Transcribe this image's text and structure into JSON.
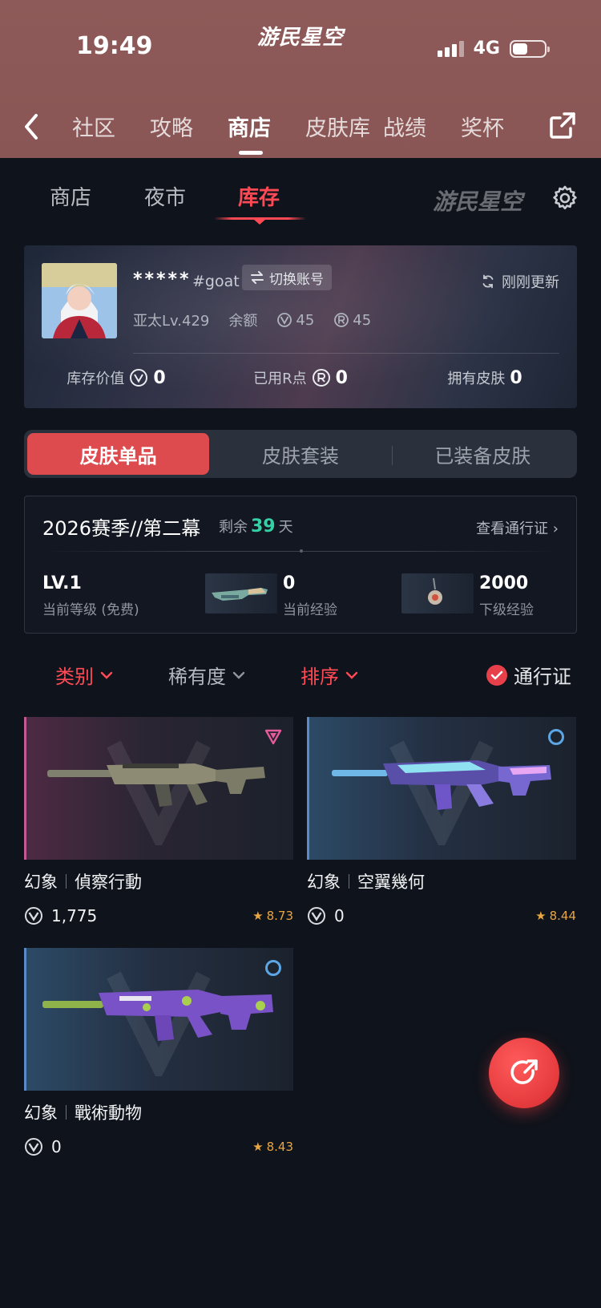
{
  "status_bar": {
    "time": "19:49",
    "brand": "游民星空",
    "network": "4G"
  },
  "nav": {
    "tabs": [
      {
        "label": "社区",
        "active": false
      },
      {
        "label": "攻略",
        "active": false
      },
      {
        "label": "商店",
        "active": true
      },
      {
        "label": "皮肤库",
        "active": false
      },
      {
        "label": "战绩",
        "active": false
      },
      {
        "label": "奖杯",
        "active": false
      }
    ]
  },
  "subtabs": {
    "items": [
      "商店",
      "夜市",
      "库存"
    ],
    "active": "库存",
    "brand": "游民星空"
  },
  "profile": {
    "name": "*****",
    "tag": "#goat",
    "switch_label": "切换账号",
    "updated_label": "刚刚更新",
    "region_level": "亚太Lv.429",
    "balance_label": "余额",
    "vp": "45",
    "rp": "45",
    "stats": [
      {
        "label": "库存价值",
        "value": "0"
      },
      {
        "label": "已用R点",
        "value": "0"
      },
      {
        "label": "拥有皮肤",
        "value": "0"
      }
    ]
  },
  "segment": {
    "items": [
      "皮肤单品",
      "皮肤套装",
      "已装备皮肤"
    ],
    "active": "皮肤单品"
  },
  "season": {
    "title": "2026赛季//第二幕",
    "remain_prefix": "剩余",
    "remain_days": "39",
    "remain_suffix": "天",
    "link": "查看通行证",
    "level_value": "LV.1",
    "level_label": "当前等级 (免费)",
    "exp_value": "0",
    "exp_label": "当前经验",
    "next_value": "2000",
    "next_label": "下级经验"
  },
  "filters": {
    "category": "类别",
    "rarity": "稀有度",
    "sort": "排序",
    "pass": "通行证"
  },
  "items": [
    {
      "weapon": "幻象",
      "skin": "偵察行動",
      "price": "1,775",
      "score": "8.73",
      "rarity_icon": "triangle-icon",
      "accent": "#c25b95"
    },
    {
      "weapon": "幻象",
      "skin": "空翼幾何",
      "price": "0",
      "score": "8.44",
      "rarity_icon": "circle-icon",
      "accent": "#5a8bc6"
    },
    {
      "weapon": "幻象",
      "skin": "戰術動物",
      "price": "0",
      "score": "8.43",
      "rarity_icon": "circle-icon",
      "accent": "#5a8bc6"
    }
  ],
  "colors": {
    "header": "#8e5a59",
    "accent_red": "#ff4a55",
    "background": "#0f131b",
    "season_days": "#35d1a5"
  }
}
